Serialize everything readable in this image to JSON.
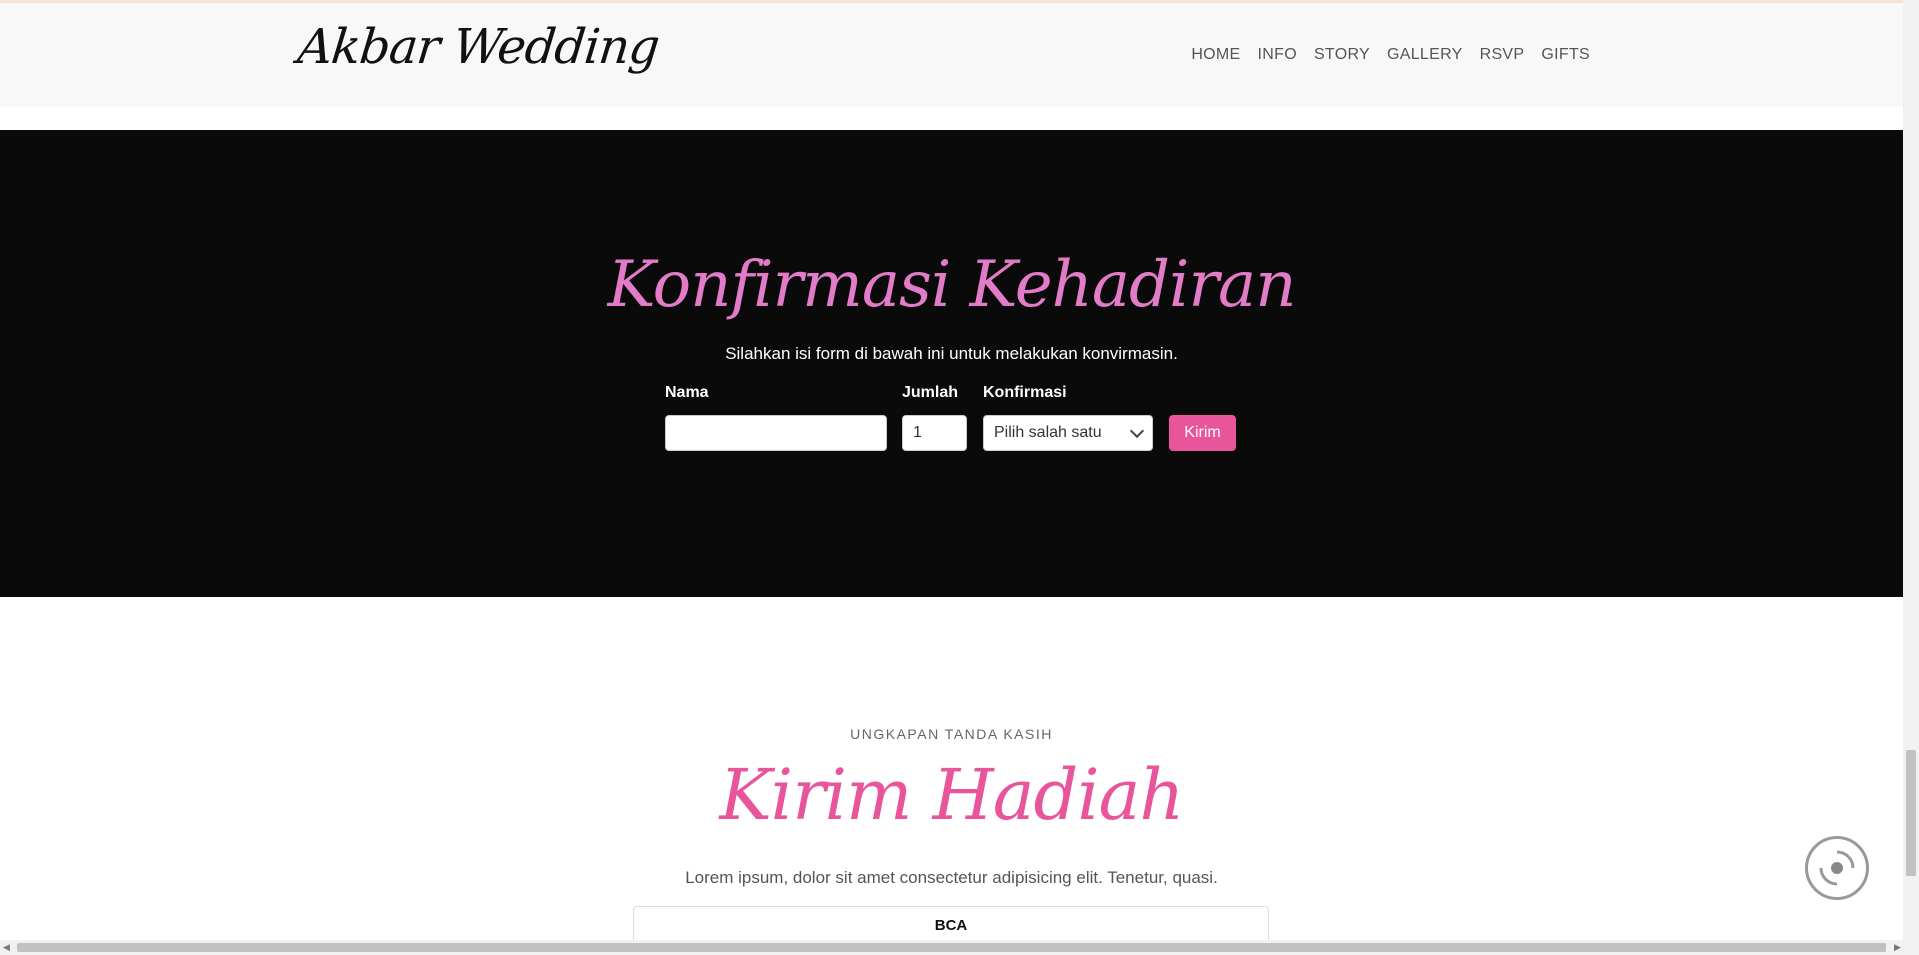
{
  "navbar": {
    "brand": "Akbar Wedding",
    "links": [
      "HOME",
      "INFO",
      "STORY",
      "GALLERY",
      "RSVP",
      "GIFTS"
    ]
  },
  "rsvp": {
    "title": "Konfirmasi Kehadiran",
    "subtitle": "Silahkan isi form di bawah ini untuk melakukan konvirmasin.",
    "fields": {
      "name_label": "Nama",
      "name_value": "",
      "count_label": "Jumlah",
      "count_value": "1",
      "confirm_label": "Konfirmasi",
      "confirm_value": "Pilih salah satu"
    },
    "submit_label": "Kirim"
  },
  "gifts": {
    "eyebrow": "UNGKAPAN TANDA KASIH",
    "title": "Kirim Hadiah",
    "description": "Lorem ipsum, dolor sit amet consectetur adipisicing elit. Tenetur, quasi.",
    "bank_name": "BCA"
  },
  "colors": {
    "accent_pink": "#e9559a",
    "title_pink": "#e27cc8",
    "dark_section": "#0a0a0a"
  },
  "icons": {
    "music_button": "music-disc-icon"
  }
}
